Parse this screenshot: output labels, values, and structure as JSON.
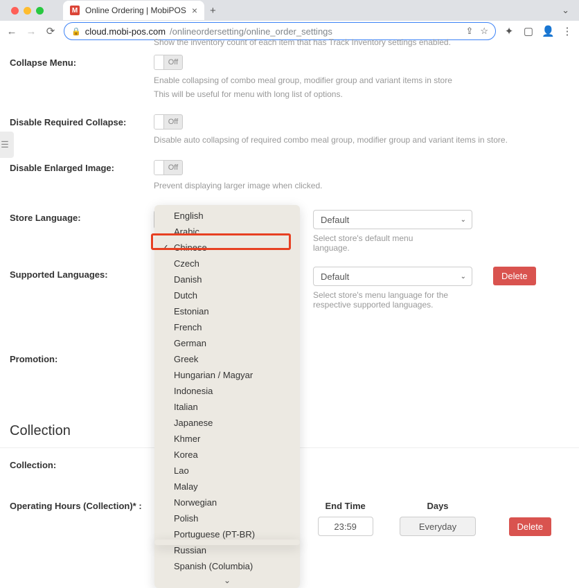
{
  "browser": {
    "tab_title": "Online Ordering | MobiPOS",
    "url_domain": "cloud.mobi-pos.com",
    "url_path": "/onlineordersetting/online_order_settings"
  },
  "truncated_help": "Show the inventory count of each item that has Track Inventory settings enabled.",
  "collapse_menu": {
    "label": "Collapse Menu:",
    "toggle": "Off",
    "help1": "Enable collapsing of combo meal group, modifier group and variant items in store",
    "help2": "This will be useful for menu with long list of options."
  },
  "disable_required": {
    "label": "Disable Required Collapse:",
    "toggle": "Off",
    "help": "Disable auto collapsing of required combo meal group, modifier group and variant items in store."
  },
  "disable_enlarged": {
    "label": "Disable Enlarged Image:",
    "toggle": "Off",
    "help": "Prevent displaying larger image when clicked."
  },
  "store_language": {
    "label": "Store Language:",
    "primary": "English",
    "secondary": "Default",
    "help": "Select store's default menu language."
  },
  "supported_languages": {
    "label": "Supported Languages:",
    "secondary": "Default",
    "help": "Select store's menu language for the respective supported languages.",
    "delete": "Delete"
  },
  "promotion": {
    "label": "Promotion:"
  },
  "collection_section": "Collection",
  "collection": {
    "label": "Collection:"
  },
  "operating_hours": {
    "label": "Operating Hours (Collection)* :",
    "end_time_label": "End Time",
    "end_time_value": "23:59",
    "days_label": "Days",
    "days_value": "Everyday",
    "delete": "Delete"
  },
  "dropdown": {
    "selected": "Chinese",
    "items": [
      "English",
      "Arabic",
      "Chinese",
      "Czech",
      "Danish",
      "Dutch",
      "Estonian",
      "French",
      "German",
      "Greek",
      "Hungarian / Magyar",
      "Indonesia",
      "Italian",
      "Japanese",
      "Khmer",
      "Korea",
      "Lao",
      "Malay",
      "Norwegian",
      "Polish",
      "Portuguese (PT-BR)",
      "Russian",
      "Spanish (Columbia)"
    ]
  }
}
